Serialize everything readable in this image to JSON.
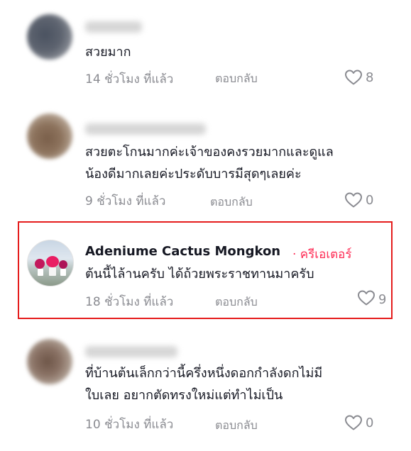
{
  "comments": [
    {
      "text": "สวยมาก",
      "time": "14 ชั่วโมง ที่แล้ว",
      "reply": "ตอบกลับ",
      "likes": "8"
    },
    {
      "text_line1": "สวยตะโกนมากค่ะเจ้าของคงรวยมากและดูแล",
      "text_line2": "น้องดีมากเลยค่ะประดับบารมีสุดๆเลยค่ะ",
      "time": "9 ชั่วโมง ที่แล้ว",
      "reply": "ตอบกลับ",
      "likes": "0"
    },
    {
      "username": "Adeniume Cactus Mongkon",
      "badge": "· ครีเอเตอร์",
      "text": "ต้นนี้ไล้านครับ ได้ถ้วยพระราชทานมาครับ",
      "time": "18 ชั่วโมง ที่แล้ว",
      "reply": "ตอบกลับ",
      "likes": "9"
    },
    {
      "text_line1": "ที่บ้านต้นเล็กกว่านี้ครึ่งหนึ่งดอกกำลังดกไม่มี",
      "text_line2": "ใบเลย อยากตัดทรงใหม่แต่ทำไม่เป็น",
      "time": "10 ชั่วโมง ที่แล้ว",
      "reply": "ตอบกลับ",
      "likes": "0"
    }
  ],
  "colors": {
    "creator_accent": "#fe2c55",
    "highlight_border": "#e51c1c",
    "meta_gray": "#8a8b91"
  },
  "icons": {
    "like": "heart-outline-icon"
  }
}
